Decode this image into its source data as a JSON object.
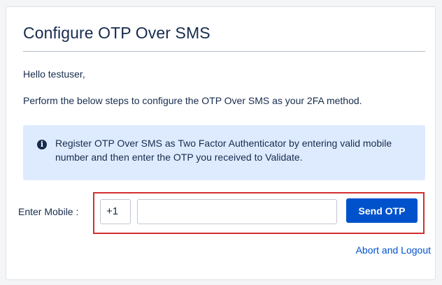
{
  "page": {
    "title": "Configure OTP Over SMS",
    "greeting": "Hello testuser,",
    "instructions": "Perform the below steps to configure the OTP Over SMS as your 2FA method."
  },
  "info": {
    "icon": "info-icon",
    "text": "Register OTP Over SMS as Two Factor Authenticator by entering valid mobile number and then enter the OTP you received to Validate."
  },
  "mobile": {
    "label": "Enter Mobile :",
    "country_code": "+1",
    "value": "",
    "placeholder": ""
  },
  "actions": {
    "send_otp_label": "Send OTP",
    "abort_label": "Abort and Logout"
  },
  "colors": {
    "accent": "#0052cc",
    "info_bg": "#deebff",
    "highlight": "#d32f2f"
  }
}
